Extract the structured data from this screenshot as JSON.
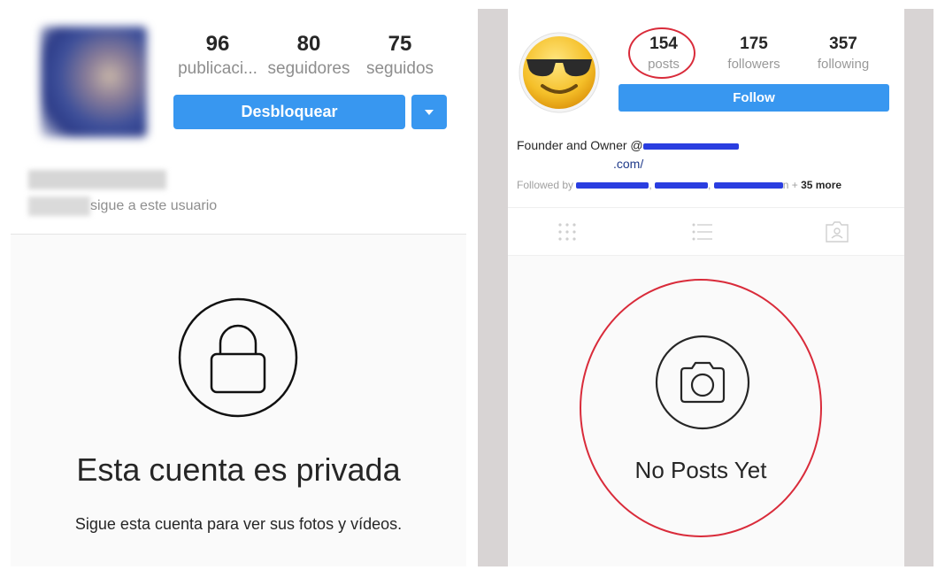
{
  "left_profile": {
    "stats": [
      {
        "value": "96",
        "label": "publicaci..."
      },
      {
        "value": "80",
        "label": "seguidores"
      },
      {
        "value": "75",
        "label": "seguidos"
      }
    ],
    "unblock_button": "Desbloquear",
    "follows_you_text": "sigue a este usuario",
    "private_title": "Esta cuenta es privada",
    "private_subtitle": "Sigue esta cuenta para ver sus fotos y vídeos.",
    "icons": {
      "lock": "lock-icon",
      "dropdown": "caret-down-icon"
    }
  },
  "right_profile": {
    "stats": [
      {
        "value": "154",
        "label": "posts"
      },
      {
        "value": "175",
        "label": "followers"
      },
      {
        "value": "357",
        "label": "following"
      }
    ],
    "follow_button": "Follow",
    "bio_prefix": "Founder and Owner @",
    "bio_line2": ".com/",
    "followed_by_prefix": "Followed by",
    "followed_by_suffix": "n +",
    "followed_by_more": "35 more",
    "empty_state_text": "No Posts Yet",
    "annotation_color": "#d92b3a",
    "redaction_color": "#2a3ee0",
    "icons": {
      "avatar": "sunglasses-emoji-icon",
      "grid": "grid-icon",
      "list": "list-icon",
      "tagged": "tagged-person-icon",
      "camera": "camera-icon"
    }
  },
  "colors": {
    "primary_button": "#3897f0",
    "text": "#262626",
    "muted": "#8e8e8e"
  }
}
